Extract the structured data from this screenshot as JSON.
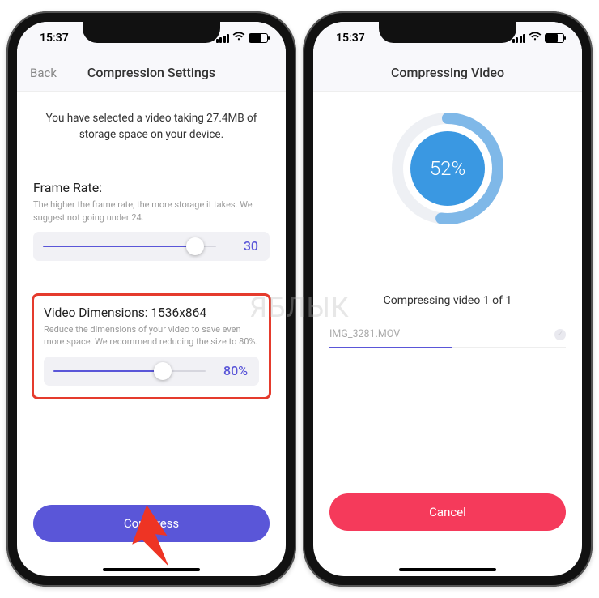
{
  "status": {
    "time": "15:37"
  },
  "left": {
    "nav": {
      "back": "Back",
      "title": "Compression Settings"
    },
    "intro": "You have selected a video taking 27.4MB of storage space on your device.",
    "frame_rate": {
      "title": "Frame Rate:",
      "desc": "The higher the frame rate, the more storage it takes. We suggest not going under 24.",
      "value": "30",
      "fill_pct": 88
    },
    "dimensions": {
      "title": "Video Dimensions: 1536x864",
      "desc": "Reduce the dimensions of your video to save even more space. We recommend reducing the size to 80%.",
      "value": "80%",
      "fill_pct": 72
    },
    "compress_label": "Compress"
  },
  "right": {
    "nav": {
      "title": "Compressing Video"
    },
    "progress_pct": "52%",
    "progress_value": 52,
    "label": "Compressing video 1 of 1",
    "file_name": "IMG_3281.MOV",
    "file_progress_pct": 52,
    "cancel_label": "Cancel"
  },
  "watermark": "ЯБЛЫК"
}
